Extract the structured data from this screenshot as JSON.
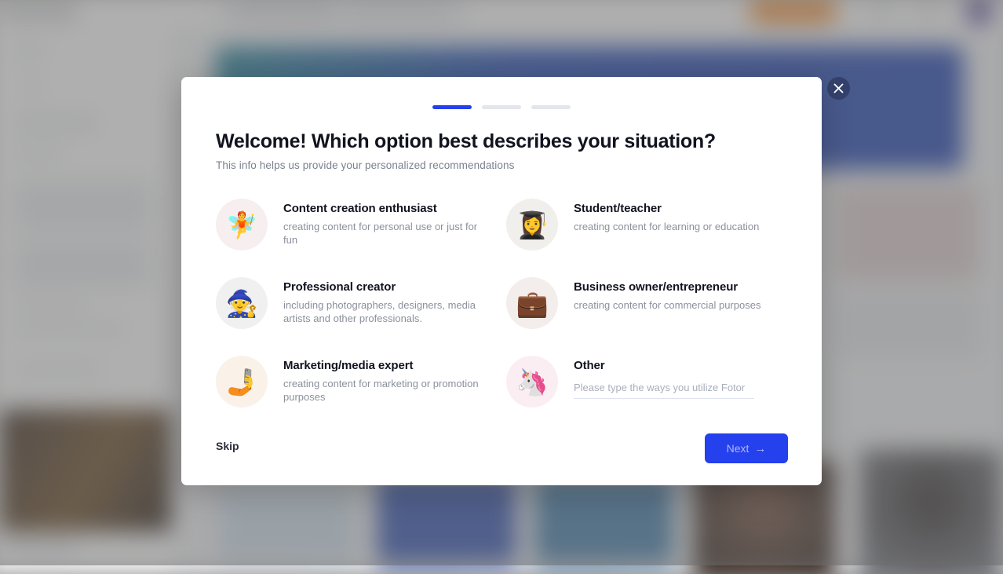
{
  "modal": {
    "progress": {
      "total": 3,
      "active_index": 0,
      "active_color": "#2540ed",
      "inactive_color": "#e3e6ec"
    },
    "title": "Welcome!  Which option best describes your situation?",
    "subtitle": "This info helps us provide your personalized recommendations",
    "options": [
      {
        "id": "content-creation-enthusiast",
        "emoji": "🧚",
        "emoji_name": "fairy-emoji",
        "circle_color": "#f7eef0",
        "title": "Content creation enthusiast",
        "description": "creating content for personal use or just for fun"
      },
      {
        "id": "student-teacher",
        "emoji": "👩‍🎓",
        "emoji_name": "graduate-emoji",
        "circle_color": "#f1efec",
        "title": "Student/teacher",
        "description": "creating content for learning or education"
      },
      {
        "id": "professional-creator",
        "emoji": "🧙",
        "emoji_name": "mage-emoji",
        "circle_color": "#eff0ef",
        "title": "Professional creator",
        "description": "including photographers, designers, media artists and other professionals."
      },
      {
        "id": "business-owner-entrepreneur",
        "emoji": "💼",
        "emoji_name": "briefcase-emoji",
        "circle_color": "#f3eeeb",
        "title": "Business owner/entrepreneur",
        "description": "creating content for commercial purposes"
      },
      {
        "id": "marketing-media-expert",
        "emoji": "🤳",
        "emoji_name": "selfie-emoji",
        "circle_color": "#faf1e8",
        "title": "Marketing/media expert",
        "description": "creating content for marketing or promotion purposes"
      },
      {
        "id": "other",
        "emoji": "🦄",
        "emoji_name": "unicorn-emoji",
        "circle_color": "#fbeef2",
        "title": "Other",
        "input_placeholder": "Please type the ways you utilize Fotor",
        "input_value": ""
      }
    ],
    "footer": {
      "skip_label": "Skip",
      "next_label": "Next",
      "next_arrow": "→",
      "next_color": "#2540ed"
    },
    "close_icon": "close-icon"
  }
}
